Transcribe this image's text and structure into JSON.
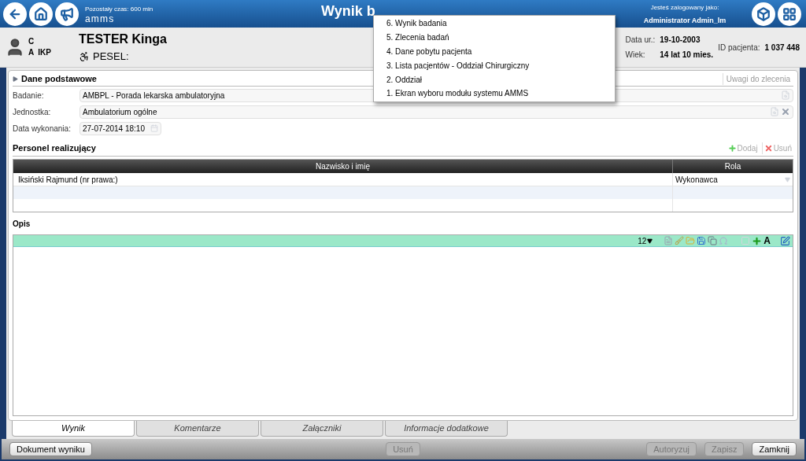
{
  "header": {
    "remaining_time": "Pozostały czas: 600 min",
    "logo": "amms",
    "title": "Wynik b",
    "logged_in_label": "Jesteś zalogowany jako:",
    "user": "Administrator Admin_lm"
  },
  "patient": {
    "flag_1": "C",
    "flag_2": "A",
    "flag_3": "IKP",
    "name": "TESTER Kinga",
    "pesel_label": "PESEL:",
    "birth_label": "Data ur.:",
    "birth": "19-10-2003",
    "age_label": "Wiek:",
    "age": "14 lat 10 mies.",
    "id_label": "ID pacjenta:",
    "id": "1 037 448"
  },
  "breadcrumb_menu": [
    "6. Wynik badania",
    "5. Zlecenia badań",
    "4. Dane pobytu pacjenta",
    "3. Lista pacjentów - Oddział Chirurgiczny",
    "2. Oddział",
    "1. Ekran wyboru modułu systemu AMMS"
  ],
  "basic": {
    "title": "Dane podstawowe",
    "notes_button": "Uwagi do zlecenia",
    "fields": [
      {
        "label": "Badanie:",
        "value": "AMBPL - Porada lekarska ambulatoryjna",
        "kind": "lookup"
      },
      {
        "label": "Jednostka:",
        "value": "Ambulatorium ogólne",
        "kind": "lookup-clear"
      },
      {
        "label": "Data wykonania:",
        "value": "27-07-2014 18:10",
        "kind": "date"
      }
    ]
  },
  "staff": {
    "title": "Personel realizujący",
    "add": {
      "label": "Dodaj",
      "disabled": true
    },
    "remove": {
      "label": "Usuń",
      "disabled": true
    },
    "columns": [
      "Nazwisko i imię",
      "Rola"
    ],
    "rows": [
      {
        "name": "Iksiński Rajmund (nr prawa:)",
        "role": "Wykonawca"
      }
    ]
  },
  "description": {
    "title": "Opis",
    "font_size": "12",
    "bold_letter": "A"
  },
  "tabs": [
    {
      "label": "Wynik",
      "selected": true
    },
    {
      "label": "Komentarze",
      "selected": false
    },
    {
      "label": "Załączniki",
      "selected": false
    },
    {
      "label": "Informacje dodatkowe",
      "selected": false
    }
  ],
  "footer": [
    {
      "label": "Dokument wyniku",
      "disabled": false,
      "kind": "left"
    },
    {
      "label": "Usuń",
      "disabled": true,
      "kind": "center"
    },
    {
      "label": "Autoryzuj",
      "disabled": true,
      "kind": "right"
    },
    {
      "label": "Zapisz",
      "disabled": true,
      "kind": "right"
    },
    {
      "label": "Zamknij",
      "disabled": false,
      "kind": "right"
    }
  ]
}
